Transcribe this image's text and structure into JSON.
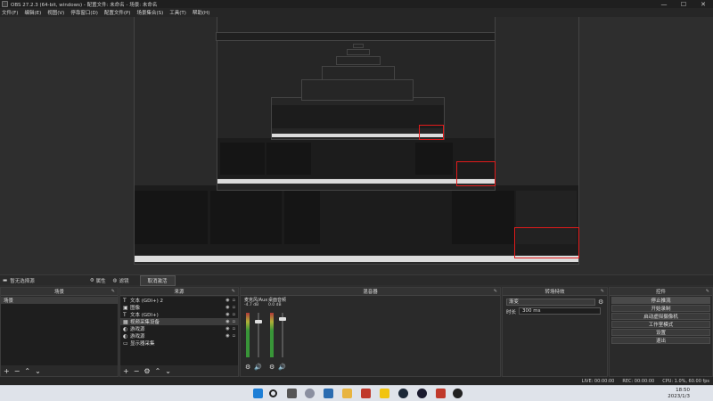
{
  "window": {
    "title": "OBS 27.2.3 (64-bit, windows) - 配置文件: 未命名 - 场景: 未命名",
    "minimize": "—",
    "maximize": "☐",
    "close": "✕"
  },
  "menu": [
    "文件(F)",
    "编辑(E)",
    "视图(V)",
    "停靠窗口(D)",
    "配置文件(P)",
    "场景集合(S)",
    "工具(T)",
    "帮助(H)"
  ],
  "contextbar": {
    "source_label": "暂无选择源",
    "properties": "属性",
    "filters": "滤镜",
    "deactivate": "取消激活"
  },
  "scenes": {
    "title": "场景",
    "items": [
      "场景"
    ]
  },
  "sources": {
    "title": "来源",
    "items": [
      {
        "icon": "T",
        "icon_name": "text-icon",
        "name": "文本 (GDI+) 2"
      },
      {
        "icon": "▣",
        "icon_name": "image-icon",
        "name": "图像"
      },
      {
        "icon": "T",
        "icon_name": "text-icon",
        "name": "文本 (GDI+)"
      },
      {
        "icon": "▦",
        "icon_name": "capture-device-icon",
        "name": "视频采集设备"
      },
      {
        "icon": "◐",
        "icon_name": "media-icon",
        "name": "游戏源"
      },
      {
        "icon": "◐",
        "icon_name": "media-icon",
        "name": "游戏源"
      },
      {
        "icon": "▭",
        "icon_name": "display-icon",
        "name": "显示器采集"
      }
    ]
  },
  "mixer": {
    "title": "混音器",
    "channels": [
      {
        "name": "麦克风/Aux",
        "db": "-4.7 dB",
        "level": 0.82
      },
      {
        "name": "桌面音频",
        "db": "0.0 dB",
        "level": 0.9
      }
    ]
  },
  "transitions": {
    "title": "转场特效",
    "type": "渐变",
    "duration_label": "时长",
    "duration": "300 ms"
  },
  "controls": {
    "title": "控件",
    "buttons": [
      "停止推流",
      "开始录制",
      "启动虚拟摄像机",
      "工作室模式",
      "设置",
      "退出"
    ]
  },
  "status": {
    "live": "LIVE: 00:00:00",
    "rec": "REC: 00:00:00",
    "cpu": "CPU: 1.0%, 60.00 fps"
  },
  "clock": {
    "time": "18:50",
    "date": "2023/1/3"
  },
  "colors": {
    "accent_red": "#e21b1b",
    "selected": "#3c3c3c"
  }
}
